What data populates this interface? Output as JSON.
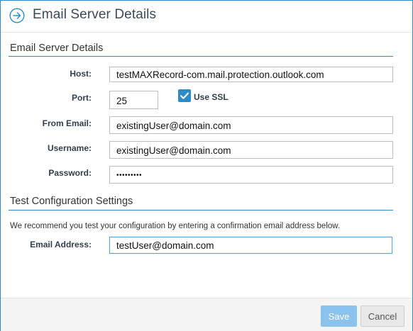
{
  "dialog": {
    "title": "Email Server Details",
    "header_icon": "arrow-circle-right-icon"
  },
  "server_section": {
    "title": "Email Server Details",
    "host": {
      "label": "Host:",
      "value": "testMAXRecord-com.mail.protection.outlook.com"
    },
    "port": {
      "label": "Port:",
      "value": "25"
    },
    "use_ssl": {
      "label": "Use SSL",
      "checked": true
    },
    "from_email": {
      "label": "From Email:",
      "value": "existingUser@domain.com"
    },
    "username": {
      "label": "Username:",
      "value": "existingUser@domain.com"
    },
    "password": {
      "label": "Password:",
      "value": "•••••••••"
    }
  },
  "test_section": {
    "title": "Test Configuration Settings",
    "info": "We recommend you test your configuration by entering a confirmation email address below.",
    "email_address": {
      "label": "Email Address:",
      "value": "testUser@domain.com"
    }
  },
  "footer": {
    "save_label": "Save",
    "cancel_label": "Cancel"
  },
  "colors": {
    "accent": "#2b8ccb",
    "save_button": "#8cc3ee",
    "cancel_button": "#e8e8e8"
  }
}
